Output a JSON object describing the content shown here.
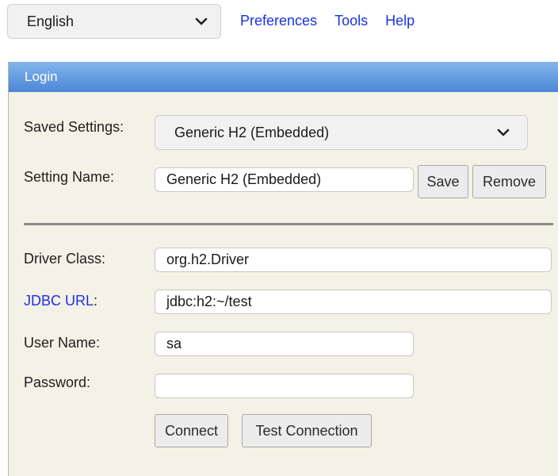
{
  "top_bar": {
    "language": "English",
    "links": {
      "preferences": "Preferences",
      "tools": "Tools",
      "help": "Help"
    }
  },
  "login_panel": {
    "title": "Login",
    "saved_settings": {
      "label": "Saved Settings:",
      "value": "Generic H2 (Embedded)"
    },
    "setting_name": {
      "label": "Setting Name:",
      "value": "Generic H2 (Embedded)",
      "save_label": "Save",
      "remove_label": "Remove"
    },
    "driver_class": {
      "label": "Driver Class:",
      "value": "org.h2.Driver"
    },
    "jdbc_url": {
      "label": "JDBC URL",
      "colon": ":",
      "value": "jdbc:h2:~/test"
    },
    "user_name": {
      "label": "User Name:",
      "value": "sa"
    },
    "password": {
      "label": "Password:",
      "value": ""
    },
    "buttons": {
      "connect": "Connect",
      "test_connection": "Test Connection"
    }
  },
  "colors": {
    "link_blue": "#1a32e6",
    "panel_bg": "#f4f1e6",
    "header_blue": "#4a86d6"
  }
}
